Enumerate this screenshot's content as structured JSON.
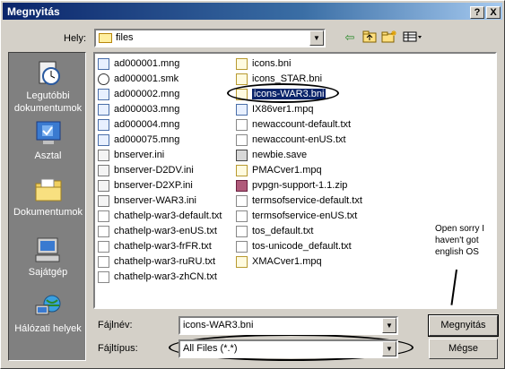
{
  "window": {
    "title": "Megnyitás",
    "help_button": "?",
    "close_button": "X"
  },
  "lookin": {
    "label": "Hely:",
    "value": "files"
  },
  "places": [
    {
      "label": "Legutóbbi dokumentumok",
      "icon": "recent-documents-icon"
    },
    {
      "label": "Asztal",
      "icon": "desktop-icon"
    },
    {
      "label": "Dokumentumok",
      "icon": "my-documents-icon"
    },
    {
      "label": "Sajátgép",
      "icon": "my-computer-icon"
    },
    {
      "label": "Hálózati helyek",
      "icon": "network-places-icon"
    }
  ],
  "files": {
    "column1": [
      {
        "name": "ad000001.mng",
        "type": "mng"
      },
      {
        "name": "ad000001.smk",
        "type": "smk"
      },
      {
        "name": "ad000002.mng",
        "type": "mng"
      },
      {
        "name": "ad000003.mng",
        "type": "mng"
      },
      {
        "name": "ad000004.mng",
        "type": "mng"
      },
      {
        "name": "ad000075.mng",
        "type": "mng"
      },
      {
        "name": "bnserver.ini",
        "type": "ini"
      },
      {
        "name": "bnserver-D2DV.ini",
        "type": "ini"
      },
      {
        "name": "bnserver-D2XP.ini",
        "type": "ini"
      },
      {
        "name": "bnserver-WAR3.ini",
        "type": "ini"
      },
      {
        "name": "chathelp-war3-default.txt",
        "type": "txt"
      },
      {
        "name": "chathelp-war3-enUS.txt",
        "type": "txt"
      },
      {
        "name": "chathelp-war3-frFR.txt",
        "type": "txt"
      },
      {
        "name": "chathelp-war3-ruRU.txt",
        "type": "txt"
      },
      {
        "name": "chathelp-war3-zhCN.txt",
        "type": "txt"
      }
    ],
    "column2": [
      {
        "name": "icons.bni",
        "type": "bni"
      },
      {
        "name": "icons_STAR.bni",
        "type": "bni"
      },
      {
        "name": "icons-WAR3.bni",
        "type": "bni",
        "selected": true
      },
      {
        "name": "IX86ver1.mpq",
        "type": "mng"
      },
      {
        "name": "newaccount-default.txt",
        "type": "txt"
      },
      {
        "name": "newaccount-enUS.txt",
        "type": "txt"
      },
      {
        "name": "newbie.save",
        "type": "save"
      },
      {
        "name": "PMACver1.mpq",
        "type": "bni"
      },
      {
        "name": "pvpgn-support-1.1.zip",
        "type": "zip"
      },
      {
        "name": "termsofservice-default.txt",
        "type": "txt"
      },
      {
        "name": "termsofservice-enUS.txt",
        "type": "txt"
      },
      {
        "name": "tos_default.txt",
        "type": "txt"
      },
      {
        "name": "tos-unicode_default.txt",
        "type": "txt"
      },
      {
        "name": "XMACver1.mpq",
        "type": "bni"
      }
    ]
  },
  "annotation": {
    "note": "Open sorry I haven't got english OS"
  },
  "filename": {
    "label": "Fájlnév:",
    "value": "icons-WAR3.bni"
  },
  "filetype": {
    "label": "Fájltípus:",
    "value": "All Files (*.*)"
  },
  "buttons": {
    "open": "Megnyitás",
    "cancel": "Mégse"
  },
  "colors": {
    "titlebar": "#0a246a",
    "face": "#d4d0c8",
    "places_bar": "#808080",
    "selection": "#0a246a"
  }
}
